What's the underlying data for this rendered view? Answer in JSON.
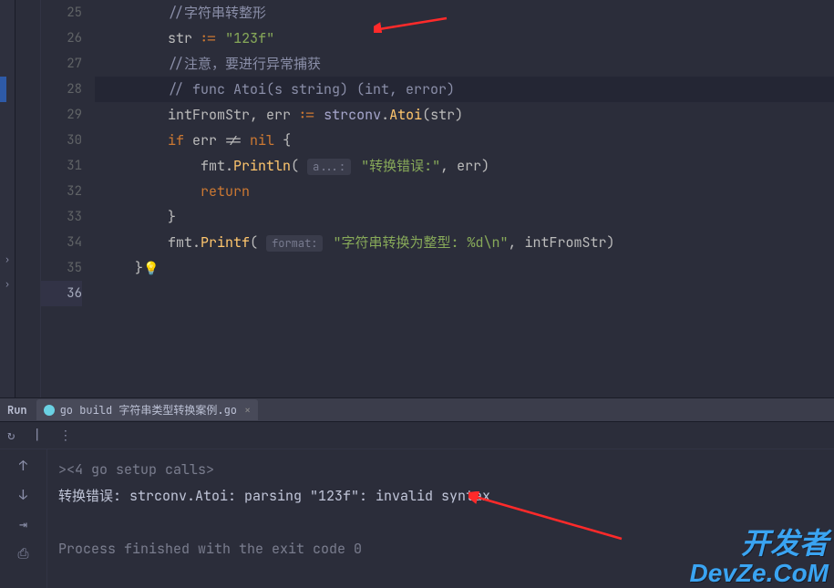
{
  "editor": {
    "lines": [
      {
        "n": 25,
        "tokens": [
          {
            "t": "//字符串转整形",
            "c": "cm"
          }
        ]
      },
      {
        "n": 26,
        "tokens": [
          {
            "t": "str ",
            "c": "id"
          },
          {
            "t": ":=",
            "c": "kw"
          },
          {
            "t": " ",
            "c": "id"
          },
          {
            "t": "\"123f\"",
            "c": "str"
          }
        ]
      },
      {
        "n": 27,
        "tokens": [
          {
            "t": "//注意，要进行异常捕获",
            "c": "cm"
          }
        ]
      },
      {
        "n": 28,
        "tokens": [
          {
            "t": "// func Atoi(s string) (int, error)",
            "c": "cm"
          }
        ]
      },
      {
        "n": 29,
        "tokens": [
          {
            "t": "intFromStr",
            "c": "id"
          },
          {
            "t": ", ",
            "c": "id"
          },
          {
            "t": "err ",
            "c": "id"
          },
          {
            "t": ":=",
            "c": "kw"
          },
          {
            "t": " ",
            "c": "id"
          },
          {
            "t": "strconv",
            "c": "pkg"
          },
          {
            "t": ".",
            "c": "id"
          },
          {
            "t": "Atoi",
            "c": "fn"
          },
          {
            "t": "(",
            "c": "id"
          },
          {
            "t": "str",
            "c": "id"
          },
          {
            "t": ")",
            "c": "id"
          }
        ]
      },
      {
        "n": 30,
        "tokens": [
          {
            "t": "if ",
            "c": "kw"
          },
          {
            "t": "err != ",
            "c": "id"
          },
          {
            "t": "nil",
            "c": "kw"
          },
          {
            "t": " {",
            "c": "id"
          }
        ]
      },
      {
        "n": 31,
        "tokens": [
          {
            "t": "    fmt.",
            "c": "id"
          },
          {
            "t": "Println",
            "c": "fn"
          },
          {
            "t": "( ",
            "c": "id"
          },
          {
            "hint": "a...:"
          },
          {
            "t": " ",
            "c": "id"
          },
          {
            "t": "\"转换错误:\"",
            "c": "str"
          },
          {
            "t": ", err)",
            "c": "id"
          }
        ]
      },
      {
        "n": 32,
        "tokens": [
          {
            "t": "    ",
            "c": "id"
          },
          {
            "t": "return",
            "c": "kw"
          }
        ]
      },
      {
        "n": 33,
        "tokens": [
          {
            "t": "}",
            "c": "id"
          }
        ]
      },
      {
        "n": 34,
        "tokens": [
          {
            "t": "fmt.",
            "c": "id"
          },
          {
            "t": "Printf",
            "c": "fn"
          },
          {
            "t": "( ",
            "c": "id"
          },
          {
            "hint": "format:"
          },
          {
            "t": " ",
            "c": "id"
          },
          {
            "t": "\"字符串转换为整型: %d\\n\"",
            "c": "str"
          },
          {
            "t": ", intFromStr)",
            "c": "id"
          }
        ]
      },
      {
        "n": 35,
        "tokens": [
          {
            "t": "}",
            "c": "id"
          },
          {
            "bulb": "💡"
          }
        ]
      },
      {
        "n": 36,
        "tokens": []
      }
    ],
    "indent": {
      "25": 2,
      "26": 2,
      "27": 2,
      "28": 2,
      "29": 2,
      "30": 2,
      "31": 2,
      "32": 2,
      "33": 2,
      "34": 2,
      "35": 1,
      "36": 0
    }
  },
  "run_panel": {
    "run_label": "Run",
    "tab_title": "go build 字符串类型转换案例.go",
    "console": [
      {
        "txt": "><4 go setup calls>",
        "cls": "gray"
      },
      {
        "txt": "转换错误: strconv.Atoi: parsing \"123f\": invalid syntax",
        "cls": "err"
      },
      {
        "txt": "",
        "cls": ""
      },
      {
        "txt": "Process finished with the exit code 0",
        "cls": "gray"
      }
    ]
  },
  "watermark": {
    "cn": "开发者",
    "en": "DevZe.CoM"
  }
}
